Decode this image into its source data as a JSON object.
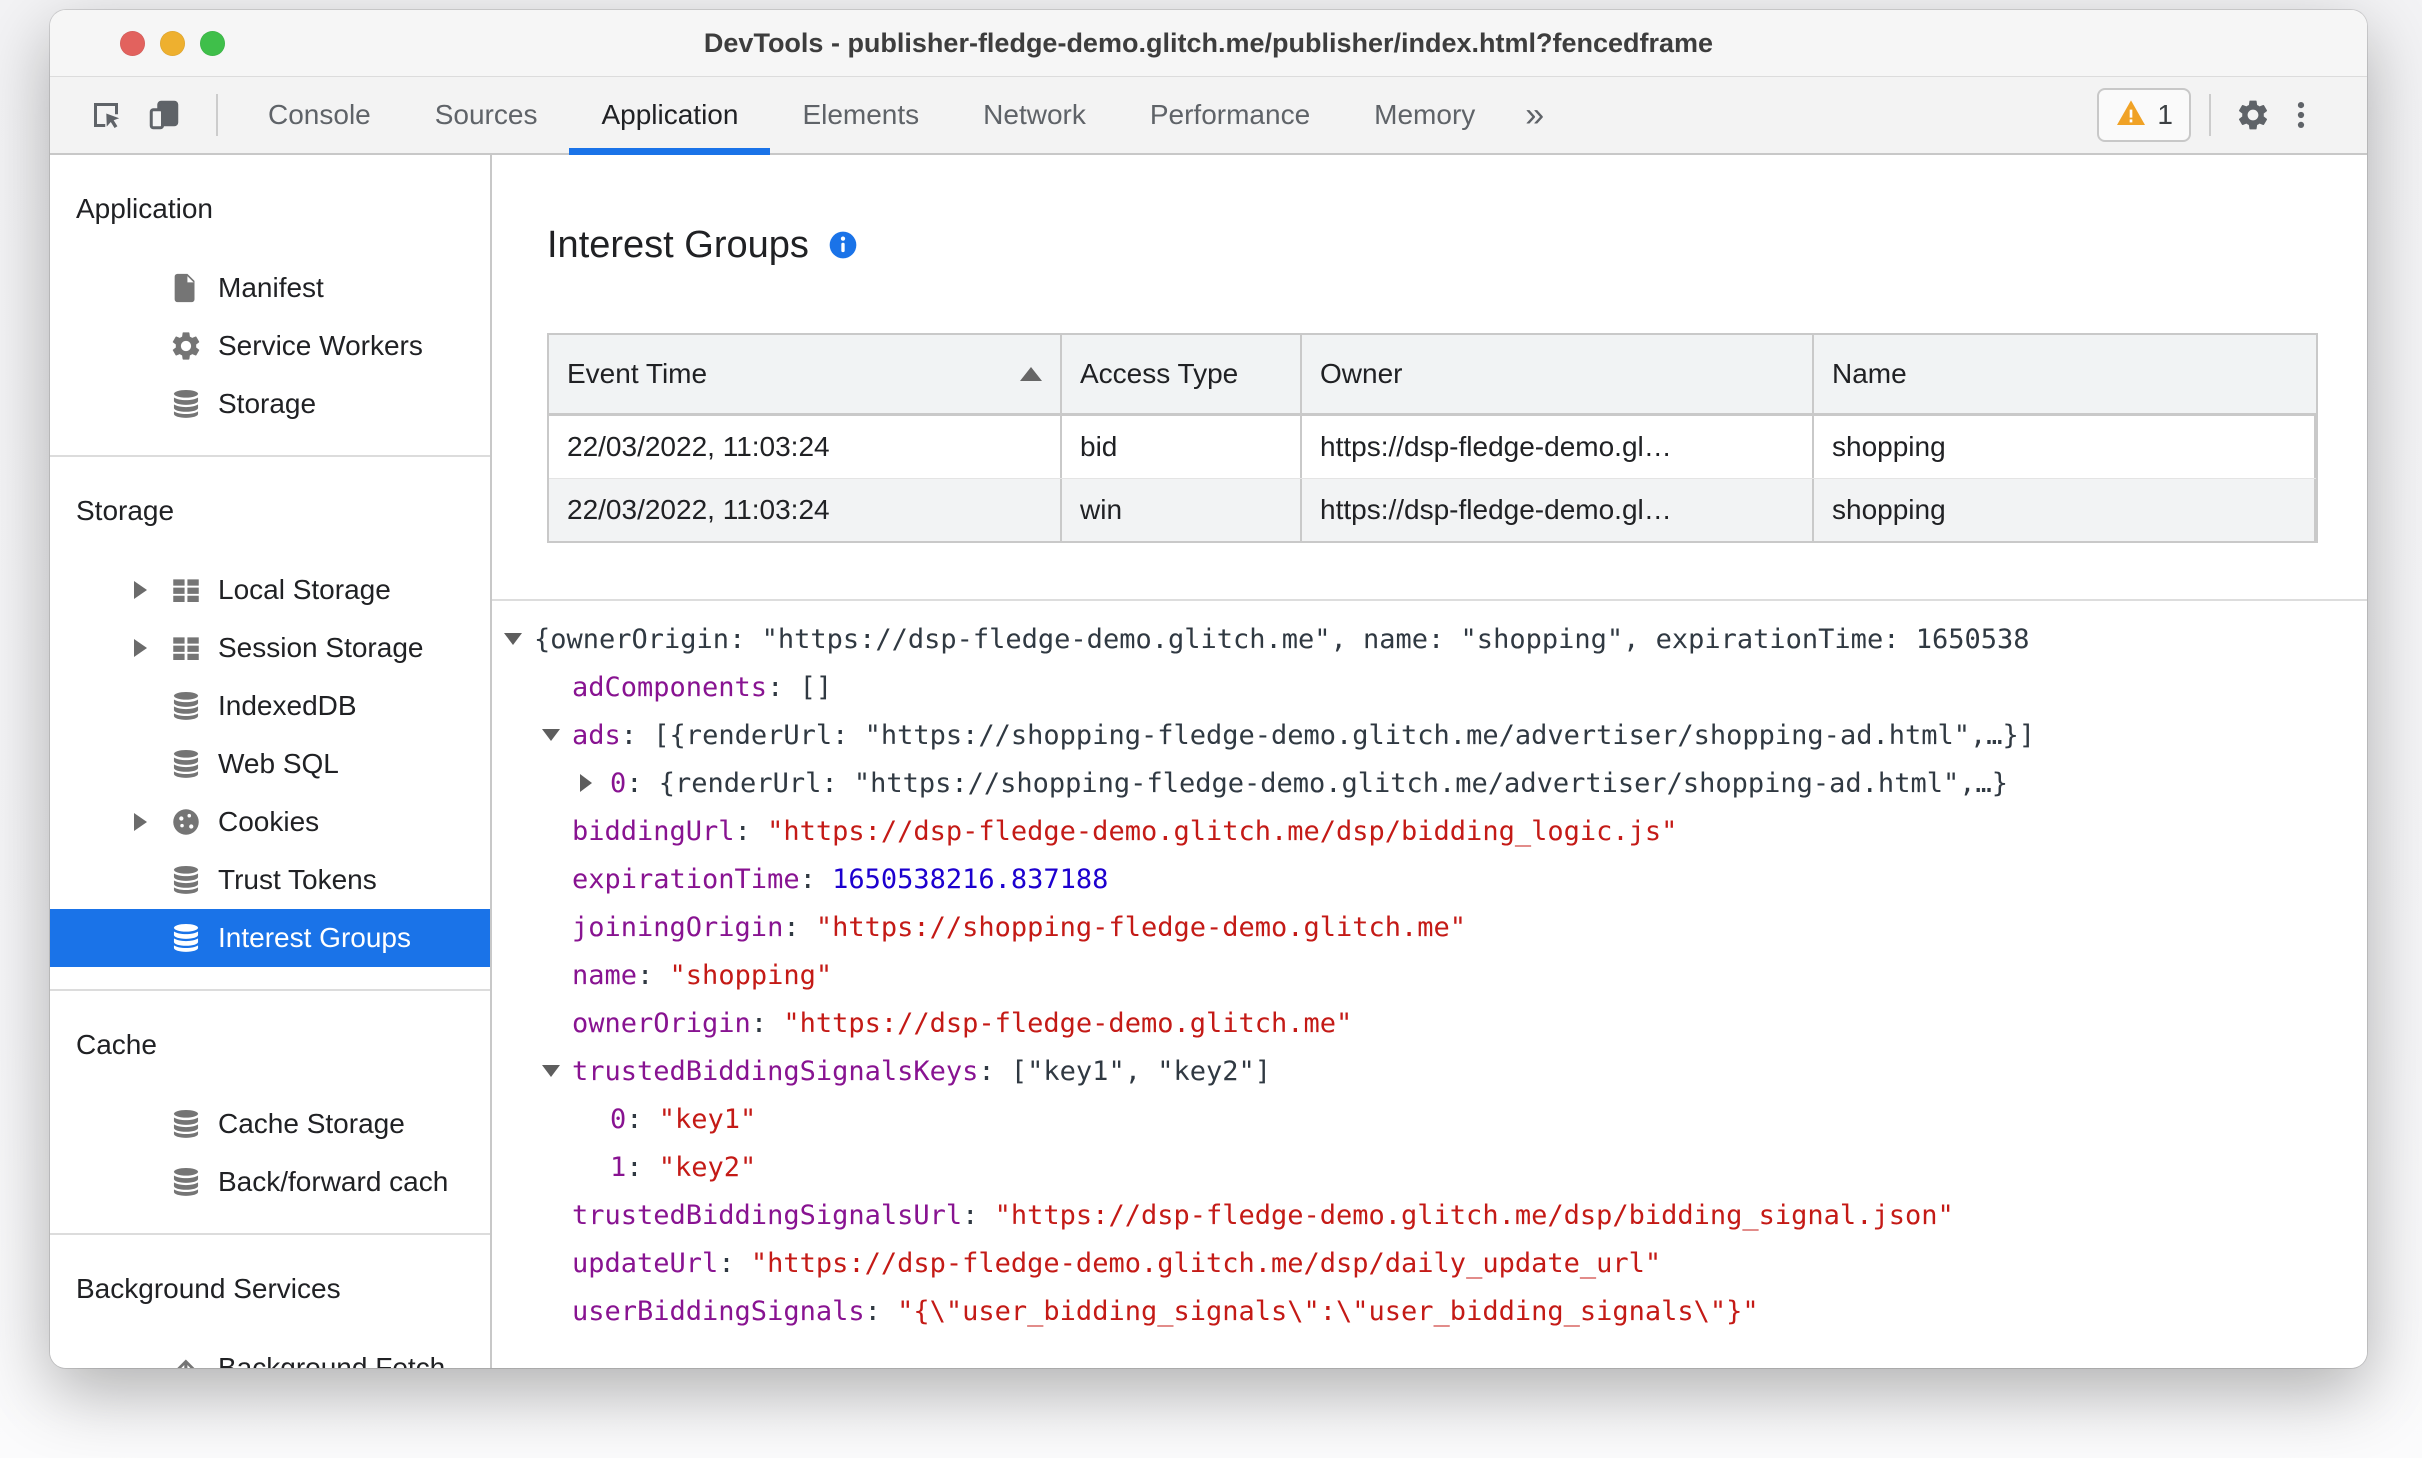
{
  "colors": {
    "accent": "#1a73e8",
    "selected_bg": "#1a73e8",
    "key_purple": "#881391",
    "string_red": "#c41a16",
    "number_blue": "#1c00cf",
    "warning_orange": "#f0a226"
  },
  "window": {
    "title": "DevTools - publisher-fledge-demo.glitch.me/publisher/index.html?fencedframe",
    "traffic_lights": [
      "close",
      "minimize",
      "zoom"
    ]
  },
  "toolbar": {
    "left_icons": [
      "inspect-icon",
      "device-toolbar-icon"
    ],
    "tabs": [
      {
        "label": "Console",
        "active": false
      },
      {
        "label": "Sources",
        "active": false
      },
      {
        "label": "Application",
        "active": true
      },
      {
        "label": "Elements",
        "active": false
      },
      {
        "label": "Network",
        "active": false
      },
      {
        "label": "Performance",
        "active": false
      },
      {
        "label": "Memory",
        "active": false
      }
    ],
    "more_tabs_glyph": "»",
    "warning_badge": {
      "icon": "warning-icon",
      "count": "1"
    },
    "right_icons": [
      "settings-gear-icon",
      "kebab-menu-icon"
    ]
  },
  "sidebar": {
    "sections": [
      {
        "title": "Application",
        "items": [
          {
            "label": "Manifest",
            "icon": "file"
          },
          {
            "label": "Service Workers",
            "icon": "gear"
          },
          {
            "label": "Storage",
            "icon": "database"
          }
        ]
      },
      {
        "title": "Storage",
        "items": [
          {
            "label": "Local Storage",
            "icon": "grid",
            "expandable": true
          },
          {
            "label": "Session Storage",
            "icon": "grid",
            "expandable": true
          },
          {
            "label": "IndexedDB",
            "icon": "database"
          },
          {
            "label": "Web SQL",
            "icon": "database"
          },
          {
            "label": "Cookies",
            "icon": "cookie",
            "expandable": true
          },
          {
            "label": "Trust Tokens",
            "icon": "database"
          },
          {
            "label": "Interest Groups",
            "icon": "database",
            "selected": true
          }
        ]
      },
      {
        "title": "Cache",
        "items": [
          {
            "label": "Cache Storage",
            "icon": "database"
          },
          {
            "label": "Back/forward cach",
            "icon": "database"
          }
        ]
      },
      {
        "title": "Background Services",
        "items": [
          {
            "label": "Background Fetch",
            "icon": "fetch"
          }
        ]
      }
    ]
  },
  "main": {
    "heading": "Interest Groups",
    "info_icon": "info-icon",
    "table": {
      "columns": [
        {
          "label": "Event Time",
          "sort": "asc"
        },
        {
          "label": "Access Type"
        },
        {
          "label": "Owner"
        },
        {
          "label": "Name"
        }
      ],
      "rows": [
        {
          "cells": [
            "22/03/2022, 11:03:24",
            "bid",
            "https://dsp-fledge-demo.gl…",
            "shopping"
          ]
        },
        {
          "cells": [
            "22/03/2022, 11:03:24",
            "win",
            "https://dsp-fledge-demo.gl…",
            "shopping"
          ]
        }
      ]
    },
    "tree": {
      "lines": [
        {
          "indent": 0,
          "arrow": "down",
          "segments": [
            {
              "text": "{ownerOrigin: \"https://dsp-fledge-demo.glitch.me\", name: \"shopping\", expirationTime: 1650538",
              "style": "preview"
            }
          ]
        },
        {
          "indent": 1,
          "segments": [
            {
              "text": "adComponents",
              "style": "key"
            },
            {
              "text": ": ",
              "style": "plain"
            },
            {
              "text": "[]",
              "style": "preview"
            }
          ]
        },
        {
          "indent": 1,
          "arrow": "down",
          "segments": [
            {
              "text": "ads",
              "style": "key"
            },
            {
              "text": ": ",
              "style": "plain"
            },
            {
              "text": "[{renderUrl: \"https://shopping-fledge-demo.glitch.me/advertiser/shopping-ad.html\",…}]",
              "style": "preview"
            }
          ]
        },
        {
          "indent": 2,
          "arrow": "right",
          "segments": [
            {
              "text": "0",
              "style": "key"
            },
            {
              "text": ": ",
              "style": "plain"
            },
            {
              "text": "{renderUrl: \"https://shopping-fledge-demo.glitch.me/advertiser/shopping-ad.html\",…}",
              "style": "preview"
            }
          ]
        },
        {
          "indent": 1,
          "segments": [
            {
              "text": "biddingUrl",
              "style": "key"
            },
            {
              "text": ": ",
              "style": "plain"
            },
            {
              "text": "\"https://dsp-fledge-demo.glitch.me/dsp/bidding_logic.js\"",
              "style": "string"
            }
          ]
        },
        {
          "indent": 1,
          "segments": [
            {
              "text": "expirationTime",
              "style": "key"
            },
            {
              "text": ": ",
              "style": "plain"
            },
            {
              "text": "1650538216.837188",
              "style": "number"
            }
          ]
        },
        {
          "indent": 1,
          "segments": [
            {
              "text": "joiningOrigin",
              "style": "key"
            },
            {
              "text": ": ",
              "style": "plain"
            },
            {
              "text": "\"https://shopping-fledge-demo.glitch.me\"",
              "style": "string"
            }
          ]
        },
        {
          "indent": 1,
          "segments": [
            {
              "text": "name",
              "style": "key"
            },
            {
              "text": ": ",
              "style": "plain"
            },
            {
              "text": "\"shopping\"",
              "style": "string"
            }
          ]
        },
        {
          "indent": 1,
          "segments": [
            {
              "text": "ownerOrigin",
              "style": "key"
            },
            {
              "text": ": ",
              "style": "plain"
            },
            {
              "text": "\"https://dsp-fledge-demo.glitch.me\"",
              "style": "string"
            }
          ]
        },
        {
          "indent": 1,
          "arrow": "down",
          "segments": [
            {
              "text": "trustedBiddingSignalsKeys",
              "style": "key"
            },
            {
              "text": ": ",
              "style": "plain"
            },
            {
              "text": "[\"key1\", \"key2\"]",
              "style": "preview"
            }
          ]
        },
        {
          "indent": 2,
          "segments": [
            {
              "text": "0",
              "style": "key"
            },
            {
              "text": ": ",
              "style": "plain"
            },
            {
              "text": "\"key1\"",
              "style": "string"
            }
          ]
        },
        {
          "indent": 2,
          "segments": [
            {
              "text": "1",
              "style": "key"
            },
            {
              "text": ": ",
              "style": "plain"
            },
            {
              "text": "\"key2\"",
              "style": "string"
            }
          ]
        },
        {
          "indent": 1,
          "segments": [
            {
              "text": "trustedBiddingSignalsUrl",
              "style": "key"
            },
            {
              "text": ": ",
              "style": "plain"
            },
            {
              "text": "\"https://dsp-fledge-demo.glitch.me/dsp/bidding_signal.json\"",
              "style": "string"
            }
          ]
        },
        {
          "indent": 1,
          "segments": [
            {
              "text": "updateUrl",
              "style": "key"
            },
            {
              "text": ": ",
              "style": "plain"
            },
            {
              "text": "\"https://dsp-fledge-demo.glitch.me/dsp/daily_update_url\"",
              "style": "string"
            }
          ]
        },
        {
          "indent": 1,
          "segments": [
            {
              "text": "userBiddingSignals",
              "style": "key"
            },
            {
              "text": ": ",
              "style": "plain"
            },
            {
              "text": "\"{\\\"user_bidding_signals\\\":\\\"user_bidding_signals\\\"}\"",
              "style": "string"
            }
          ]
        }
      ]
    }
  }
}
